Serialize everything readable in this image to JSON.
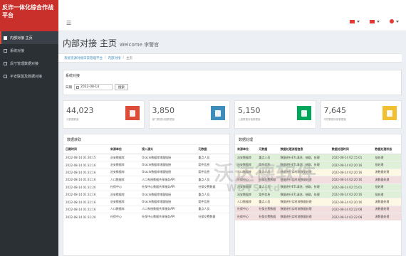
{
  "app": {
    "title": "反诈一体化综合作战平台"
  },
  "topbar": {
    "menu_icon": "hamburger-icon"
  },
  "sidebar": {
    "items": [
      {
        "label": "内部对接 主页",
        "icon": "home-icon",
        "active": true
      },
      {
        "label": "系统对接",
        "icon": "grid-icon",
        "active": false
      },
      {
        "label": "反厅管理数据对接",
        "icon": "monitor-icon",
        "active": false
      },
      {
        "label": "平安联盟及数据对接",
        "icon": "link-icon",
        "active": false
      }
    ]
  },
  "page": {
    "title": "内部对接 主页",
    "welcome": "Welcome 李警官"
  },
  "breadcrumb": {
    "items": [
      "系统资源对接日常管理平台",
      "内部对接",
      "主页"
    ]
  },
  "search": {
    "title": "系统对接",
    "date_label": "日期",
    "date_value": "2022-08-14",
    "button_label": "搜索"
  },
  "stats": [
    {
      "value": "44,023",
      "label": "元数据数量",
      "color": "#dd4b39",
      "icon": "database-icon"
    },
    {
      "value": "3,850",
      "label": "部门数据对接数据量",
      "color": "#3c8dbc",
      "icon": "folder-icon"
    },
    {
      "value": "5,150",
      "label": "上报数据对接数据量",
      "color": "#00a65a",
      "icon": "folder-open-icon"
    },
    {
      "value": "7,645",
      "label": "专项数据对接数据量",
      "color": "#f0c030",
      "icon": "folder-icon"
    }
  ],
  "left_panel": {
    "title": "数据获取",
    "headers": [
      "日期时间",
      "来源单位",
      "接入源头",
      "元数据"
    ],
    "rows": [
      [
        "2022-08-14 01:30:15",
        "治安数据库",
        "Oracle数据库增量链接",
        "重点人员"
      ],
      [
        "2022-08-14 01:31:16",
        "治安数据库",
        "Oracle数据库增量链接",
        "案件信息"
      ],
      [
        "2022-08-14 01:31:16",
        "治安数据库",
        "Oracle数据库增量链接",
        "案件信息"
      ],
      [
        "2022-08-14 01:31:16",
        "人口数据库",
        "人口系统数据共享服务API",
        "重点人员"
      ],
      [
        "2022-08-14 01:31:20",
        "社保中心",
        "社保中心数据共享服务API",
        "社保交费数据"
      ],
      [
        "2022-08-14 01:31:16",
        "治安数据库",
        "Oracle数据库增量链接",
        "重点人员"
      ],
      [
        "2022-08-14 01:31:16",
        "治安数据库",
        "Oracle数据库增量链接",
        "案件信息"
      ],
      [
        "2022-08-14 01:31:16",
        "人口数据库",
        "人口系统数据共享服务API",
        "重点人员"
      ],
      [
        "2022-08-14 01:31:20",
        "社保中心",
        "社保中心数据共享服务API",
        "社保交费数据"
      ]
    ]
  },
  "right_panel": {
    "title": "数据处理",
    "headers": [
      "来源单位",
      "元数据",
      "数据处理流程信息",
      "数据处理时间",
      "数据处理状态"
    ],
    "rows": [
      {
        "cells": [
          "治安数据库",
          "重点人员",
          "数据进行ETL清洗、抽取、处理",
          "2022-08-14 02:15:01",
          "批处理"
        ],
        "status": "g"
      },
      {
        "cells": [
          "治安数据库",
          "案件信息",
          "数据进行ETL清洗、抽取、处理",
          "2022-08-14 02:20:16",
          "批处理"
        ],
        "status": "g"
      },
      {
        "cells": [
          "人口数据库",
          "重点人员",
          "数据进行实时流数据处理",
          "2022-08-14 02:20:16",
          "流数据处理"
        ],
        "status": "y"
      },
      {
        "cells": [
          "社保中心",
          "社保交费数据",
          "数据进行实时流数据处理",
          "2022-08-14 02:20:16",
          "流数据处理"
        ],
        "status": "r"
      },
      {
        "cells": [
          "治安数据库",
          "重点人员",
          "数据进行ETL清洗、抽取、处理",
          "2022-08-14 02:15:01",
          "批处理"
        ],
        "status": "g"
      },
      {
        "cells": [
          "治安数据库",
          "案件信息",
          "数据进行ETL清洗、抽取、处理",
          "2022-08-14 02:20:16",
          "批处理"
        ],
        "status": "g"
      },
      {
        "cells": [
          "人口数据库",
          "重点人员",
          "数据进行实时流数据处理",
          "2022-08-14 02:20:16",
          "流数据处理"
        ],
        "status": "y"
      },
      {
        "cells": [
          "社保中心",
          "社保交费数据",
          "数据进行实时流数据处理",
          "2022-08-14 02:22:08",
          "流数据处理"
        ],
        "status": "r"
      },
      {
        "cells": [
          "社保中心",
          "社保交费数据",
          "数据进行实时流数据处理",
          "2022-08-14 02:22:08",
          "流数据处理"
        ],
        "status": "r"
      }
    ]
  },
  "watermark": {
    "line1": "沃达德软件",
    "line2": "WDTS.ltd"
  }
}
